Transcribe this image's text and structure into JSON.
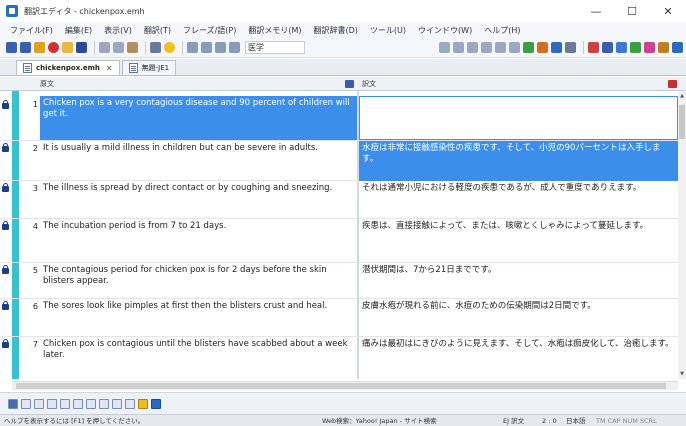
{
  "window": {
    "title": "翻訳エディタ - chickenpox.emh",
    "minimize_symbol": "—",
    "maximize_symbol": "☐",
    "close_symbol": "✕"
  },
  "menu": [
    {
      "label": "ファイル(F)"
    },
    {
      "label": "編集(E)"
    },
    {
      "label": "表示(V)"
    },
    {
      "label": "翻訳(T)"
    },
    {
      "label": "フレーズ/語(P)"
    },
    {
      "label": "翻訳メモリ(M)"
    },
    {
      "label": "翻訳辞書(D)"
    },
    {
      "label": "ツール(U)"
    },
    {
      "label": "ウインドウ(W)"
    },
    {
      "label": "ヘルプ(H)"
    }
  ],
  "toolbar": {
    "dictionary_field": "医学"
  },
  "tabs": [
    {
      "label": "chickenpox.emh",
      "close": "✕",
      "active": true
    },
    {
      "label": "無題-JE1",
      "close": "",
      "active": false
    }
  ],
  "columns": {
    "source": "原文",
    "target": "訳文"
  },
  "rows": [
    {
      "num": "1",
      "source": "Chicken pox is a very contagious disease and 90 percent of children will get it.",
      "target": ""
    },
    {
      "num": "2",
      "source": "It is usually a mild illness in children but can be severe in adults.",
      "target": "水痘は非常に接触感染性の疾患です、そして、小児の90パーセントは入手します。"
    },
    {
      "num": "3",
      "source": "The illness is spread by direct contact or by coughing and sneezing.",
      "target": "それは通常小児における軽度の疾患であるが、成人で重度でありえます。"
    },
    {
      "num": "4",
      "source": "The incubation period is from 7 to 21 days.",
      "target": "疾患は、直接接触によって、または、咳嗽とくしゃみによって蔓延します。"
    },
    {
      "num": "5",
      "source": "The contagious period for chicken pox is for 2 days before the skin blisters appear.",
      "target": "潜伏期間は、7から21日までです。"
    },
    {
      "num": "6",
      "source": "The sores look like pimples at first then the blisters crust and heal.",
      "target": "皮膚水疱が現れる前に、水痘のための伝染期間は2日間です。"
    },
    {
      "num": "7",
      "source": "Chicken pox is contagious until the blisters have scabbed about a week later.",
      "target": "痛みは最初はにきびのように見えます、そして、水疱は痂皮化して、治癒します。"
    }
  ],
  "status": {
    "help_hint": "ヘルプを表示するには [F1] を押してください。",
    "web_search": "Web検索：Yahoo! Japan - サイト検索",
    "mode": "EJ 訳文",
    "position": "2 : 0",
    "language": "日本語",
    "indicators": "TM CAP NUM SCRL"
  },
  "colors": {
    "selection": "#3b8fea",
    "teal_strip": "#33c3d3",
    "lock": "#1a3f8a"
  }
}
